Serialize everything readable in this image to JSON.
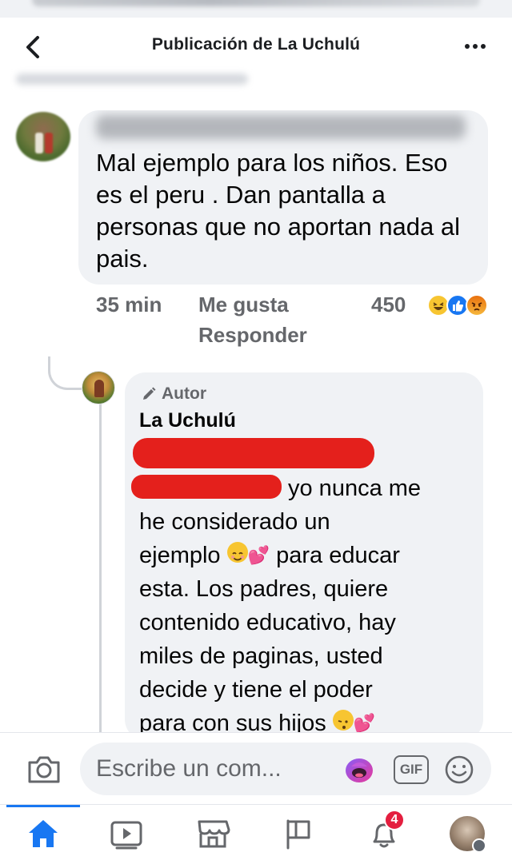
{
  "header": {
    "title": "Publicación de La Uchulú"
  },
  "comment": {
    "text": "Mal ejemplo para los niños. Eso es el peru . Dan pantalla a personas que no aportan nada al pais.",
    "time": "35 min",
    "like_label": "Me gusta",
    "reply_label": "Responder",
    "reaction_count": "450",
    "reactions": [
      "haha-icon",
      "like-icon",
      "angry-icon"
    ]
  },
  "reply": {
    "badge": "Autor",
    "author": "La Uchulú",
    "line1": "yo nunca me",
    "line2": "he considerado un",
    "line3a": "ejemplo",
    "line3b": "para educar",
    "line4": "esta. Los padres, quiere",
    "line5": "contenido educativo, hay",
    "line6": "miles de paginas, usted",
    "line7": "decide y tiene el poder",
    "line8": "para con sus hijos"
  },
  "composer": {
    "placeholder": "Escribe un com...",
    "gif_label": "GIF"
  },
  "tabbar": {
    "notifications_badge": "4",
    "active_tab": "home",
    "accent": "#1877f2"
  },
  "colors": {
    "bubble": "#f0f2f5",
    "meta_text": "#65676b",
    "redaction": "#e4201c"
  }
}
